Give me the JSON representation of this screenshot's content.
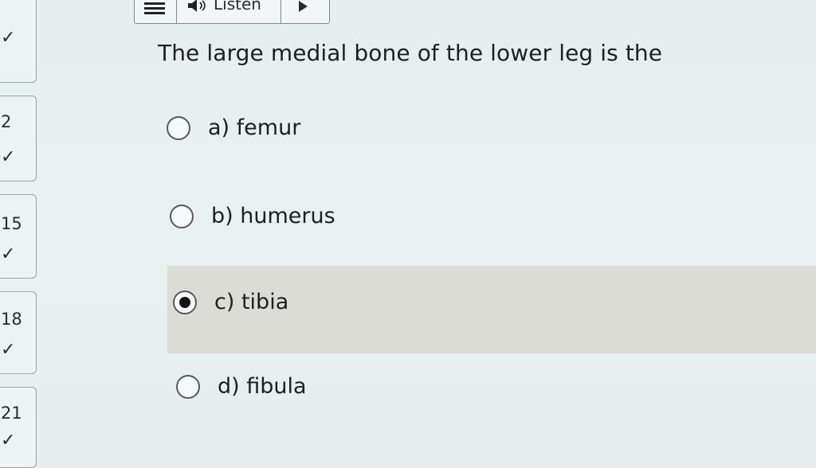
{
  "toolbar": {
    "listen_label": "Listen",
    "menu_icon": "hamburger-icon",
    "speaker_icon": "speaker-icon",
    "play_icon": "play-icon"
  },
  "navigator": {
    "items": [
      {
        "number": "",
        "check": "✓"
      },
      {
        "number": "2",
        "check": "✓"
      },
      {
        "number": "15",
        "check": "✓"
      },
      {
        "number": "18",
        "check": "✓"
      },
      {
        "number": "21",
        "check": "✓"
      }
    ]
  },
  "question": {
    "text": "The large medial bone of the lower leg is the"
  },
  "options": [
    {
      "label": "a)  femur",
      "selected": false
    },
    {
      "label": "b)  humerus",
      "selected": false
    },
    {
      "label": "c)  tibia",
      "selected": true
    },
    {
      "label": "d)  fibula",
      "selected": false
    }
  ],
  "colors": {
    "background": "#e6eef0",
    "selected_band": "#dcdcd6",
    "border": "#7f878b"
  }
}
